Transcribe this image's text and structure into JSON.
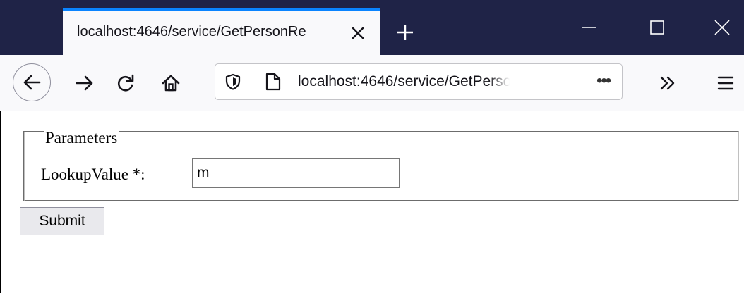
{
  "browser": {
    "tab": {
      "title": "localhost:4646/service/GetPersonRe"
    },
    "address_bar": {
      "url": "localhost:4646/service/GetPerson"
    },
    "icons": [
      "close-tab-icon",
      "new-tab-icon",
      "minimize-icon",
      "maximize-icon",
      "close-window-icon",
      "back-icon",
      "forward-icon",
      "reload-icon",
      "home-icon",
      "tracking-shield-icon",
      "page-icon",
      "page-actions-icon",
      "overflow-icon",
      "menu-icon"
    ],
    "accent_color": "#0a84ff",
    "titlebar_color": "#1f2347"
  },
  "page": {
    "fieldset": {
      "legend": "Parameters",
      "field_label": "LookupValue *:",
      "field_value": "m"
    },
    "submit_label": "Submit"
  }
}
